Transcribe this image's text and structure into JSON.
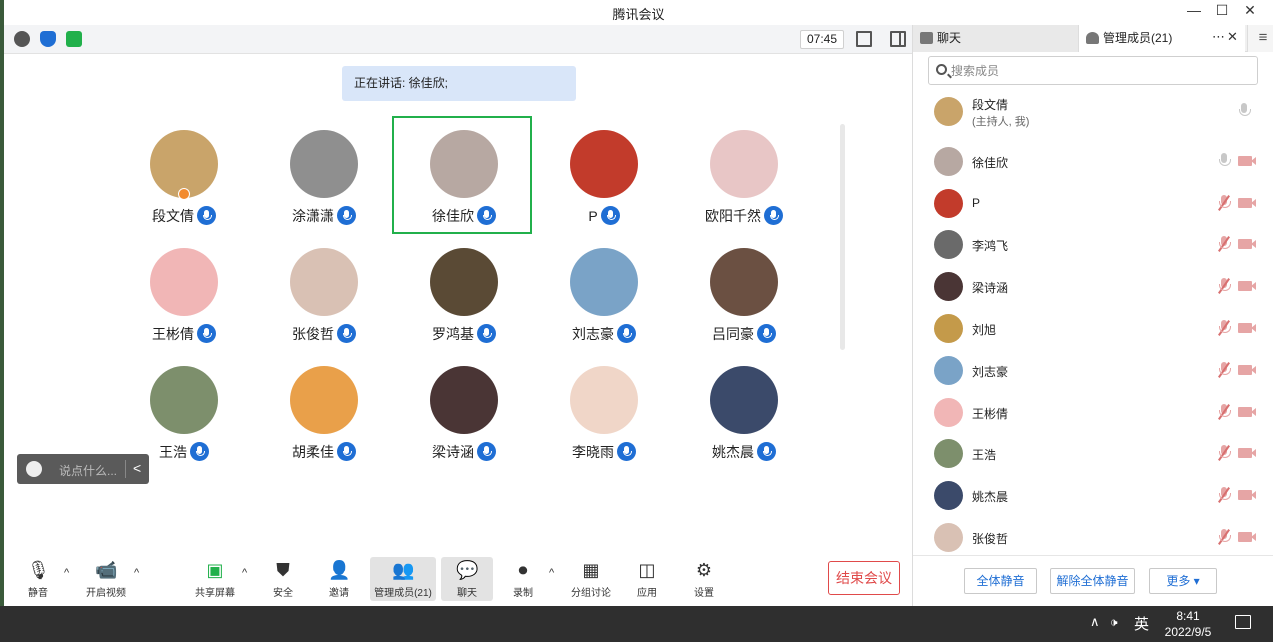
{
  "window": {
    "title": "腾讯会议",
    "minimize": "—",
    "maximize": "☐",
    "close": "✕"
  },
  "topbar": {
    "timer": "07:45"
  },
  "speaking_label": "正在讲话: 徐佳欣;",
  "participants": [
    {
      "name": "段文倩",
      "color": "#c9a46a",
      "host": true
    },
    {
      "name": "涂潇潇",
      "color": "#8f8f8f"
    },
    {
      "name": "徐佳欣",
      "color": "#b7a8a2",
      "active": true
    },
    {
      "name": "P",
      "color": "#c23b2b"
    },
    {
      "name": "欧阳千然",
      "color": "#e8c6c6"
    },
    {
      "name": "王彬倩",
      "color": "#f1b6b6"
    },
    {
      "name": "张俊哲",
      "color": "#d9c1b4"
    },
    {
      "name": "罗鸿基",
      "color": "#5a4a35"
    },
    {
      "name": "刘志豪",
      "color": "#7aa3c7"
    },
    {
      "name": "吕同豪",
      "color": "#6b5042"
    },
    {
      "name": "王浩",
      "color": "#7d8f6c"
    },
    {
      "name": "胡柔佳",
      "color": "#e9a04a"
    },
    {
      "name": "梁诗涵",
      "color": "#4a3535"
    },
    {
      "name": "李晓雨",
      "color": "#f0d6c8"
    },
    {
      "name": "姚杰晨",
      "color": "#3b4a6a"
    }
  ],
  "chat_input": {
    "placeholder": "说点什么...",
    "collapse": "<"
  },
  "bottombar": {
    "mute": "静音",
    "video": "开启视频",
    "share": "共享屏幕",
    "security": "安全",
    "invite": "邀请",
    "members": "管理成员(21)",
    "chat": "聊天",
    "record": "录制",
    "breakout": "分组讨论",
    "apps": "应用",
    "settings": "设置",
    "end": "结束会议",
    "caret": "^"
  },
  "panel": {
    "tab_chat": "聊天",
    "tab_members": "管理成员(21)",
    "more": "⋯",
    "close": "✕",
    "menu": "≡",
    "search_placeholder": "搜索成员",
    "members": [
      {
        "name": "段文倩",
        "sub": "(主持人, 我)",
        "color": "#c9a46a",
        "host": true
      },
      {
        "name": "徐佳欣",
        "color": "#b7a8a2"
      },
      {
        "name": "P",
        "color": "#c23b2b"
      },
      {
        "name": "李鸿飞",
        "color": "#6a6a6a"
      },
      {
        "name": "梁诗涵",
        "color": "#4a3535"
      },
      {
        "name": "刘旭",
        "color": "#c49a4a"
      },
      {
        "name": "刘志豪",
        "color": "#7aa3c7"
      },
      {
        "name": "王彬倩",
        "color": "#f1b6b6"
      },
      {
        "name": "王浩",
        "color": "#7d8f6c"
      },
      {
        "name": "姚杰晨",
        "color": "#3b4a6a"
      },
      {
        "name": "张俊哲",
        "color": "#d9c1b4"
      }
    ],
    "mute_all": "全体静音",
    "unmute_all": "解除全体静音",
    "more_btn": "更多 ▾"
  },
  "taskbar": {
    "up": "∧",
    "volume": "🕩",
    "ime": "英",
    "time": "8:41",
    "date": "2022/9/5"
  }
}
